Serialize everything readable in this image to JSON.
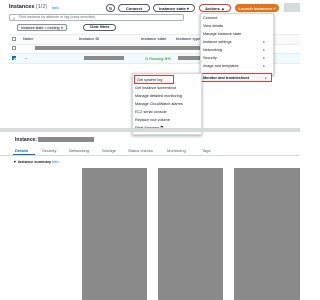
{
  "header": {
    "title": "Instances",
    "count": "(1/2)",
    "info": "Info",
    "connect_label": "Connect",
    "instance_state_label": "Instance state ▾",
    "actions_label": "Actions ▲",
    "launch_label": "Launch instances ▾"
  },
  "search": {
    "placeholder": "Find instance by attribute or tag (case-sensitive)"
  },
  "filter": {
    "chip_label": "Instance state = running ✕",
    "clear_label": "Clear filters"
  },
  "table": {
    "columns": [
      "Name",
      "Instance ID",
      "Instance state",
      "Instance type",
      "Status check",
      "Alarm status",
      "Availability Zone",
      "Public IP"
    ],
    "rows": [
      {
        "selected": false,
        "status": ""
      },
      {
        "selected": true,
        "name": "–",
        "status": "⊙ Running ⊕⊖"
      }
    ]
  },
  "actions_menu": {
    "items": [
      "Connect",
      "View details",
      "Manage instance state",
      "Instance settings",
      "Networking",
      "Security",
      "Image and templates",
      "Monitor and troubleshoot"
    ],
    "highlighted": "Monitor and troubleshoot"
  },
  "submenu": {
    "items": [
      "Get system log",
      "Get instance screenshot",
      "Manage detailed monitoring",
      "Manage CloudWatch alarms",
      "EC2 serial console",
      "Replace root volume",
      "Fleet Manager ⧉"
    ],
    "highlighted": "Get system log"
  },
  "details": {
    "title": "Instance:",
    "tabs": [
      "Details",
      "Security",
      "Networking",
      "Storage",
      "Status checks",
      "Monitoring",
      "Tags"
    ],
    "active_tab": "Details",
    "summary_label": "▼ Instance summary",
    "summary_info": "Info"
  },
  "colors": {
    "accent": "#0073bb",
    "primary": "#ec7211",
    "highlight": "#e53935",
    "redacted": "#8a8a8a"
  }
}
